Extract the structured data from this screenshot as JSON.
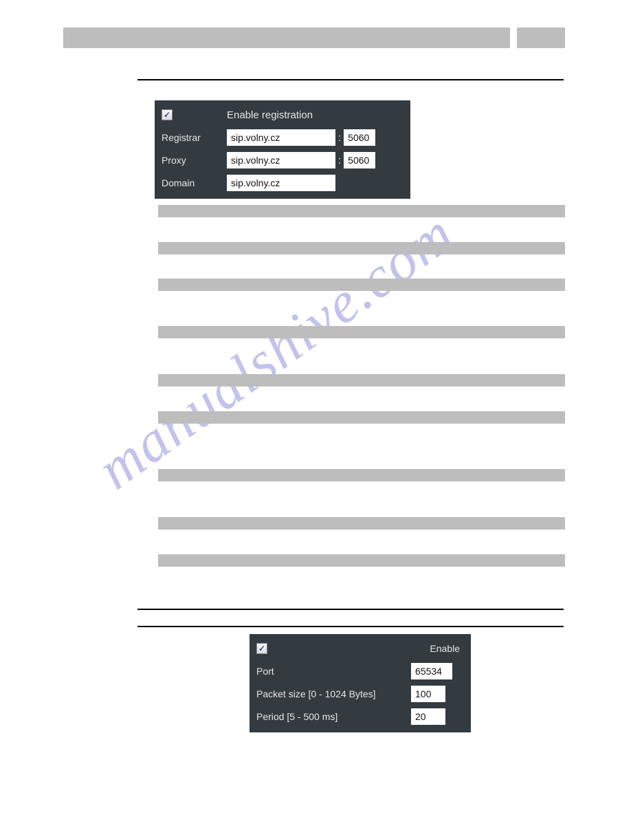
{
  "watermark": "manualshive.com",
  "panel1": {
    "enable_checked": true,
    "enable_label": "Enable registration",
    "rows": [
      {
        "label": "Registrar",
        "host": "sip.volny.cz",
        "port": "5060",
        "has_port": true
      },
      {
        "label": "Proxy",
        "host": "sip.volny.cz",
        "port": "5060",
        "has_port": true
      },
      {
        "label": "Domain",
        "host": "sip.volny.cz",
        "port": "",
        "has_port": false
      }
    ]
  },
  "panel2": {
    "enable_checked": true,
    "enable_label": "Enable",
    "rows": [
      {
        "label": "Port",
        "value": "65534"
      },
      {
        "label": "Packet size [0 - 1024 Bytes]",
        "value": "100"
      },
      {
        "label": "Period [5 - 500 ms]",
        "value": "20"
      }
    ]
  },
  "check_glyph": "✓"
}
